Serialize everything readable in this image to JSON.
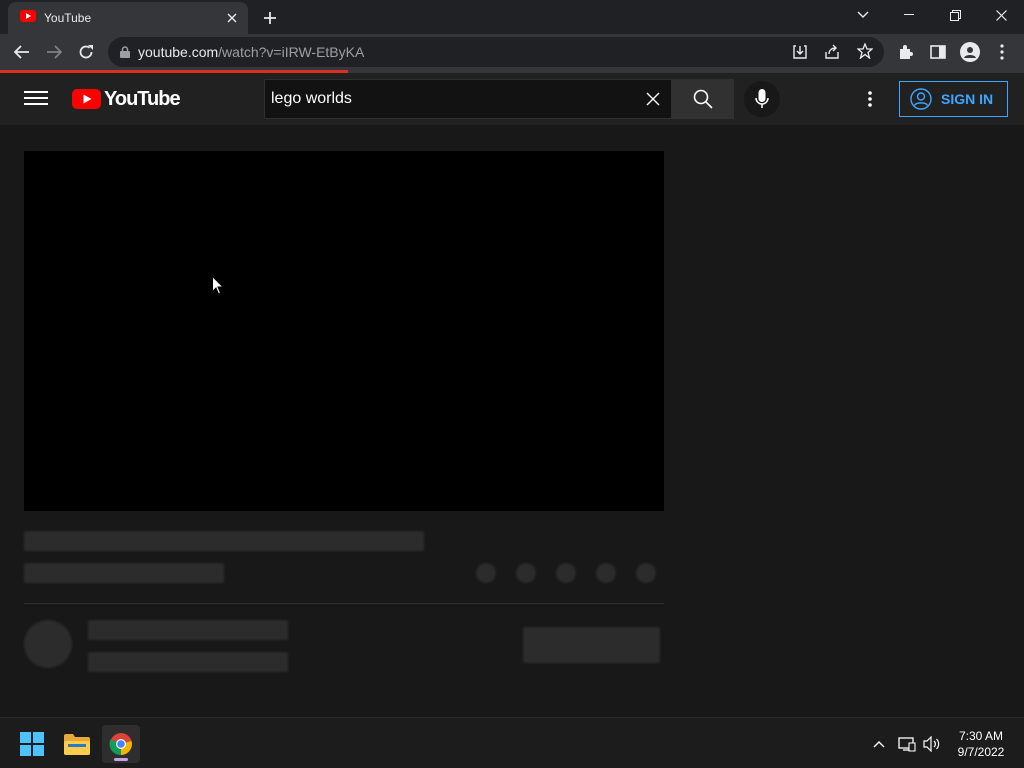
{
  "browser": {
    "tab_title": "YouTube",
    "url_host": "youtube.com",
    "url_path": "/watch?v=iIRW-EtByKA"
  },
  "youtube": {
    "logo_text": "YouTube",
    "search_value": "lego worlds",
    "signin_label": "SIGN IN"
  },
  "taskbar": {
    "time": "7:30 AM",
    "date": "9/7/2022"
  },
  "colors": {
    "accent_blue": "#3ea6ff",
    "youtube_red": "#ff0000",
    "loading_red": "#d93025"
  }
}
